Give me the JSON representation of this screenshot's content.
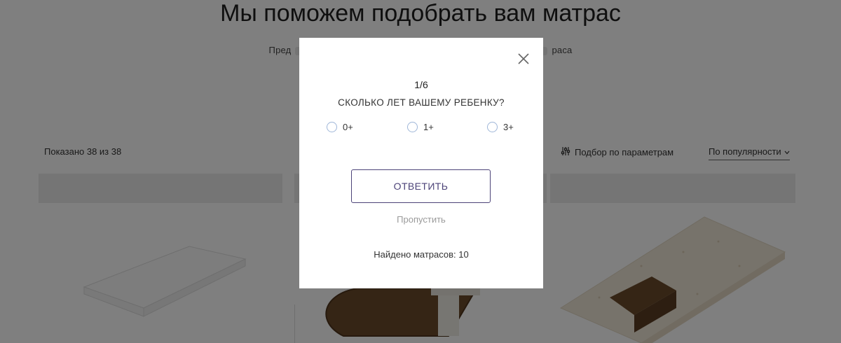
{
  "page": {
    "headline": "Мы поможем подобрать вам матрас",
    "subtitle_start": "Пред",
    "subtitle_end": "раса",
    "shown_count": "Показано 38 из 38",
    "filter_label": "Подбор по параметрам",
    "sort_label": "По популярности"
  },
  "modal": {
    "step": "1/6",
    "question": "СКОЛЬКО ЛЕТ ВАШЕМУ РЕБЕНКУ?",
    "options": [
      {
        "label": "0+",
        "selected": false
      },
      {
        "label": "1+",
        "selected": false
      },
      {
        "label": "3+",
        "selected": false
      }
    ],
    "answer_label": "ОТВЕТИТЬ",
    "skip_label": "Пропустить",
    "found_label": "Найдено матрасов: 10"
  },
  "icons": {
    "close": "close-icon",
    "filter": "sliders-icon",
    "sort": "chevron-down-icon"
  },
  "colors": {
    "accent": "#4c4378",
    "overlay": "rgba(0,0,0,0.5)",
    "radio_border": "#9fb6d8",
    "muted_text": "#9a9a9a"
  }
}
